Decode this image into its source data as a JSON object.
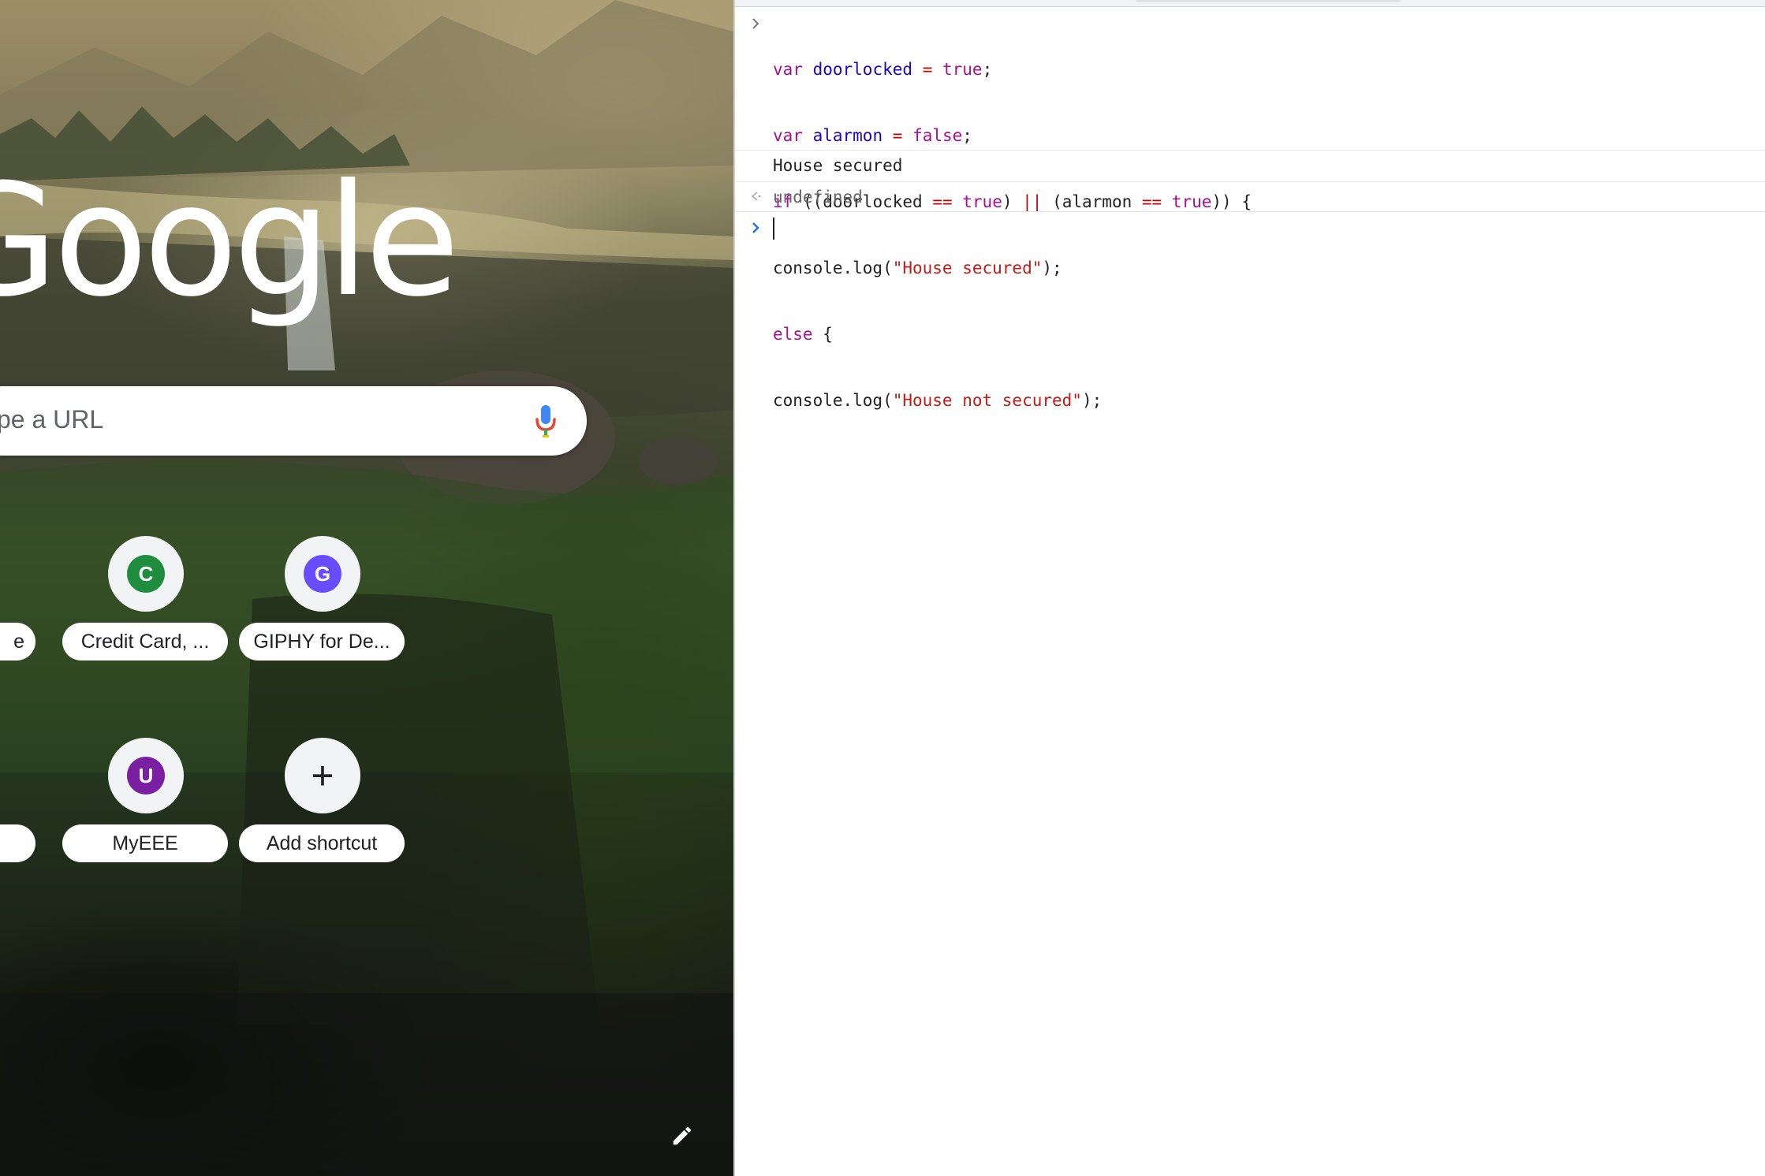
{
  "ntp": {
    "logo_text": "Google",
    "search": {
      "placeholder": "ype a URL"
    },
    "shortcuts": [
      {
        "label": "e",
        "initial": "",
        "color": "#9aa0a6"
      },
      {
        "label": "Credit Card, ...",
        "initial": "C",
        "color": "#1e8e3e"
      },
      {
        "label": "GIPHY for De...",
        "initial": "G",
        "color": "#6a4cff"
      },
      {
        "label": "",
        "initial": "",
        "color": "#9aa0a6"
      },
      {
        "label": "MyEEE",
        "initial": "U",
        "color": "#7b1fa2"
      },
      {
        "label": "Add shortcut",
        "initial": "+",
        "color": ""
      }
    ]
  },
  "console": {
    "input_lines": [
      [
        "var",
        " ",
        "doorlocked",
        " ",
        "=",
        " ",
        "true",
        ";"
      ],
      [
        "var",
        " ",
        "alarmon",
        " ",
        "=",
        " ",
        "false",
        ";"
      ],
      [
        "if",
        " ((doorlocked ",
        "==",
        " ",
        "true",
        ") ",
        "||",
        " (alarmon ",
        "==",
        " ",
        "true",
        ")) {"
      ],
      [
        "console.log(",
        "\"House secured\"",
        ");"
      ],
      [
        "else",
        " {"
      ],
      [
        "console.log(",
        "\"House not secured\"",
        ");"
      ]
    ],
    "log_output": "House secured",
    "return_value": "undefined"
  }
}
